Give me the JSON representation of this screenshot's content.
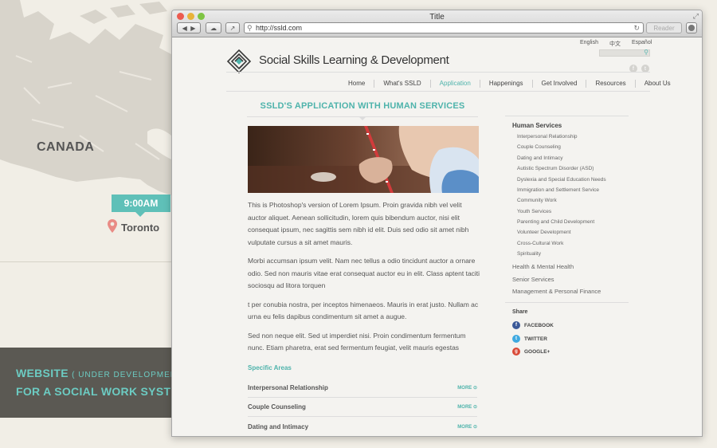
{
  "background": {
    "country": "CANADA",
    "clock": "9:00AM",
    "city": "Toronto",
    "banner_line1_main": "WEBSITE",
    "banner_line1_paren": "( UNDER DEVELOPMENT )",
    "banner_line2": "FOR A SOCIAL WORK SYSTEM"
  },
  "browser": {
    "title": "Title",
    "url": "http://ssld.com",
    "reader": "Reader"
  },
  "site": {
    "title": "Social Skills Learning & Development",
    "languages": [
      "English",
      "中文",
      "Español"
    ],
    "nav": [
      "Home",
      "What's SSLD",
      "Application",
      "Happenings",
      "Get Involved",
      "Resources",
      "About Us"
    ],
    "active_nav": "Application",
    "page_heading": "SSLD's Application with Human Services",
    "paragraphs": [
      "This is Photoshop's version  of Lorem Ipsum. Proin gravida nibh vel velit auctor aliquet. Aenean sollicitudin, lorem quis bibendum auctor, nisi elit consequat ipsum, nec sagittis sem nibh id elit. Duis sed odio sit amet nibh vulputate cursus a sit amet mauris.",
      "Morbi accumsan ipsum velit. Nam nec tellus a odio tincidunt auctor a ornare odio. Sed non  mauris vitae erat consequat auctor eu in elit. Class aptent taciti sociosqu ad litora torquen",
      "t per conubia nostra, per inceptos himenaeos. Mauris in erat justo. Nullam ac urna eu felis dapibus condimentum sit amet a augue.",
      "Sed non neque elit. Sed ut imperdiet nisi. Proin condimentum fermentum nunc. Etiam pharetra, erat sed fermentum feugiat, velit mauris egestas"
    ],
    "specific_areas_title": "Specific Areas",
    "areas": [
      "Interpersonal Relationship",
      "Couple Counseling",
      "Dating and Intimacy"
    ],
    "more_label": "MORE",
    "sidebar": {
      "heading": "Human Services",
      "items": [
        "Interpersonal Relationship",
        "Couple Counseling",
        "Dating and Intimacy",
        "Autistic Spectrum Disorder (ASD)",
        "Dyslexia and Special Education Needs",
        "Immigration and Settlement Service",
        "Community Work",
        "Youth Services",
        "Parenting and Child Development",
        "Volunteer Development",
        "Cross-Cultural Work",
        "Spirituality"
      ],
      "categories": [
        "Health & Mental Health",
        "Senior Services",
        "Management & Personal Finance"
      ]
    },
    "share": {
      "title": "Share",
      "items": [
        {
          "label": "FACEBOOK",
          "icon": "facebook-icon",
          "color": "#3b5998"
        },
        {
          "label": "TWITTER",
          "icon": "twitter-icon",
          "color": "#3fa9e0"
        },
        {
          "label": "GOOGLE+",
          "icon": "google-plus-icon",
          "color": "#d94a38"
        }
      ]
    }
  },
  "colors": {
    "accent": "#4eb3ab",
    "banner": "#5b5953"
  }
}
